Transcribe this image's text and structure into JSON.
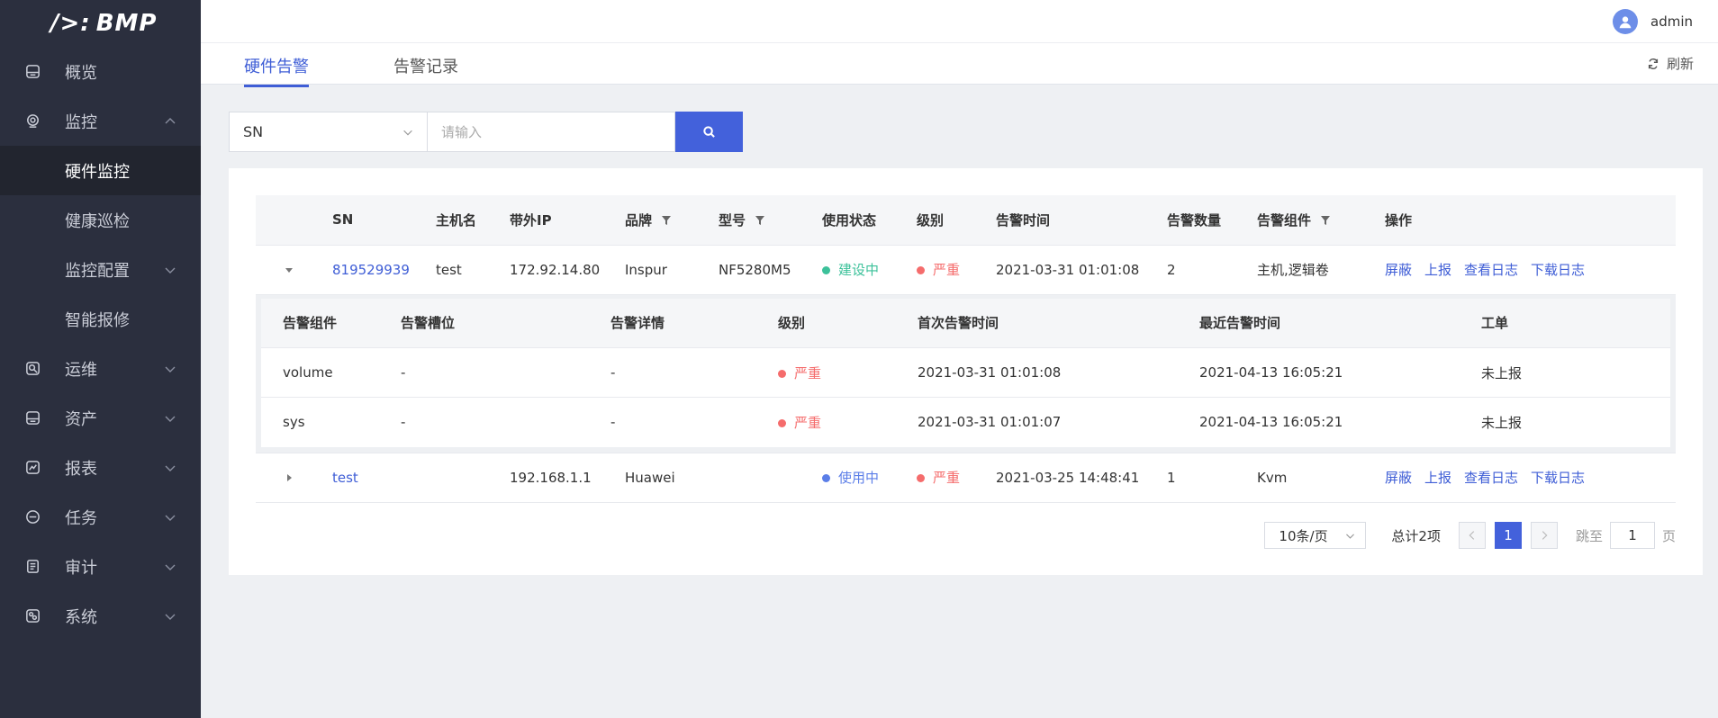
{
  "sidebar": {
    "logo": "BMP",
    "items": [
      {
        "label": "概览",
        "icon": "overview-icon"
      },
      {
        "label": "监控",
        "icon": "monitor-icon"
      },
      {
        "label": "运维",
        "icon": "ops-icon"
      },
      {
        "label": "资产",
        "icon": "asset-icon"
      },
      {
        "label": "报表",
        "icon": "report-icon"
      },
      {
        "label": "任务",
        "icon": "task-icon"
      },
      {
        "label": "审计",
        "icon": "audit-icon"
      },
      {
        "label": "系统",
        "icon": "system-icon"
      }
    ],
    "monitor_children": [
      {
        "label": "硬件监控"
      },
      {
        "label": "健康巡检"
      },
      {
        "label": "监控配置"
      },
      {
        "label": "智能报修"
      }
    ]
  },
  "header": {
    "user": "admin"
  },
  "tabs": [
    {
      "label": "硬件告警"
    },
    {
      "label": "告警记录"
    }
  ],
  "refresh_label": "刷新",
  "search": {
    "select_value": "SN",
    "placeholder": "请输入"
  },
  "table": {
    "headers": [
      "SN",
      "主机名",
      "带外IP",
      "品牌",
      "型号",
      "使用状态",
      "级别",
      "告警时间",
      "告警数量",
      "告警组件",
      "操作"
    ],
    "ops": [
      "屏蔽",
      "上报",
      "查看日志",
      "下载日志"
    ],
    "rows": [
      {
        "sn": "819529939",
        "hostname": "test",
        "ip": "172.92.14.80",
        "brand": "Inspur",
        "model": "NF5280M5",
        "status": "建设中",
        "status_color": "#3cc19a",
        "level": "严重",
        "level_color": "#f56c6c",
        "time": "2021-03-31 01:01:08",
        "count": "2",
        "component": "主机,逻辑卷"
      },
      {
        "sn": "test",
        "hostname": "",
        "ip": "192.168.1.1",
        "brand": "Huawei",
        "model": "",
        "status": "使用中",
        "status_color": "#5b7ee8",
        "level": "严重",
        "level_color": "#f56c6c",
        "time": "2021-03-25 14:48:41",
        "count": "1",
        "component": "Kvm"
      }
    ],
    "sub_headers": [
      "告警组件",
      "告警槽位",
      "告警详情",
      "级别",
      "首次告警时间",
      "最近告警时间",
      "工单"
    ],
    "sub_rows": [
      {
        "component": "volume",
        "slot": "-",
        "detail": "-",
        "level": "严重",
        "first": "2021-03-31 01:01:08",
        "last": "2021-04-13 16:05:21",
        "ticket": "未上报"
      },
      {
        "component": "sys",
        "slot": "-",
        "detail": "-",
        "level": "严重",
        "first": "2021-03-31 01:01:07",
        "last": "2021-04-13 16:05:21",
        "ticket": "未上报"
      }
    ]
  },
  "pagination": {
    "page_size": "10条/页",
    "total": "总计2项",
    "current": "1",
    "jump_label": "跳至",
    "jump_value": "1",
    "page_suffix": "页"
  },
  "colors": {
    "accent": "#4361db",
    "sidebar_bg": "#2b2f3e",
    "danger": "#f56c6c"
  }
}
